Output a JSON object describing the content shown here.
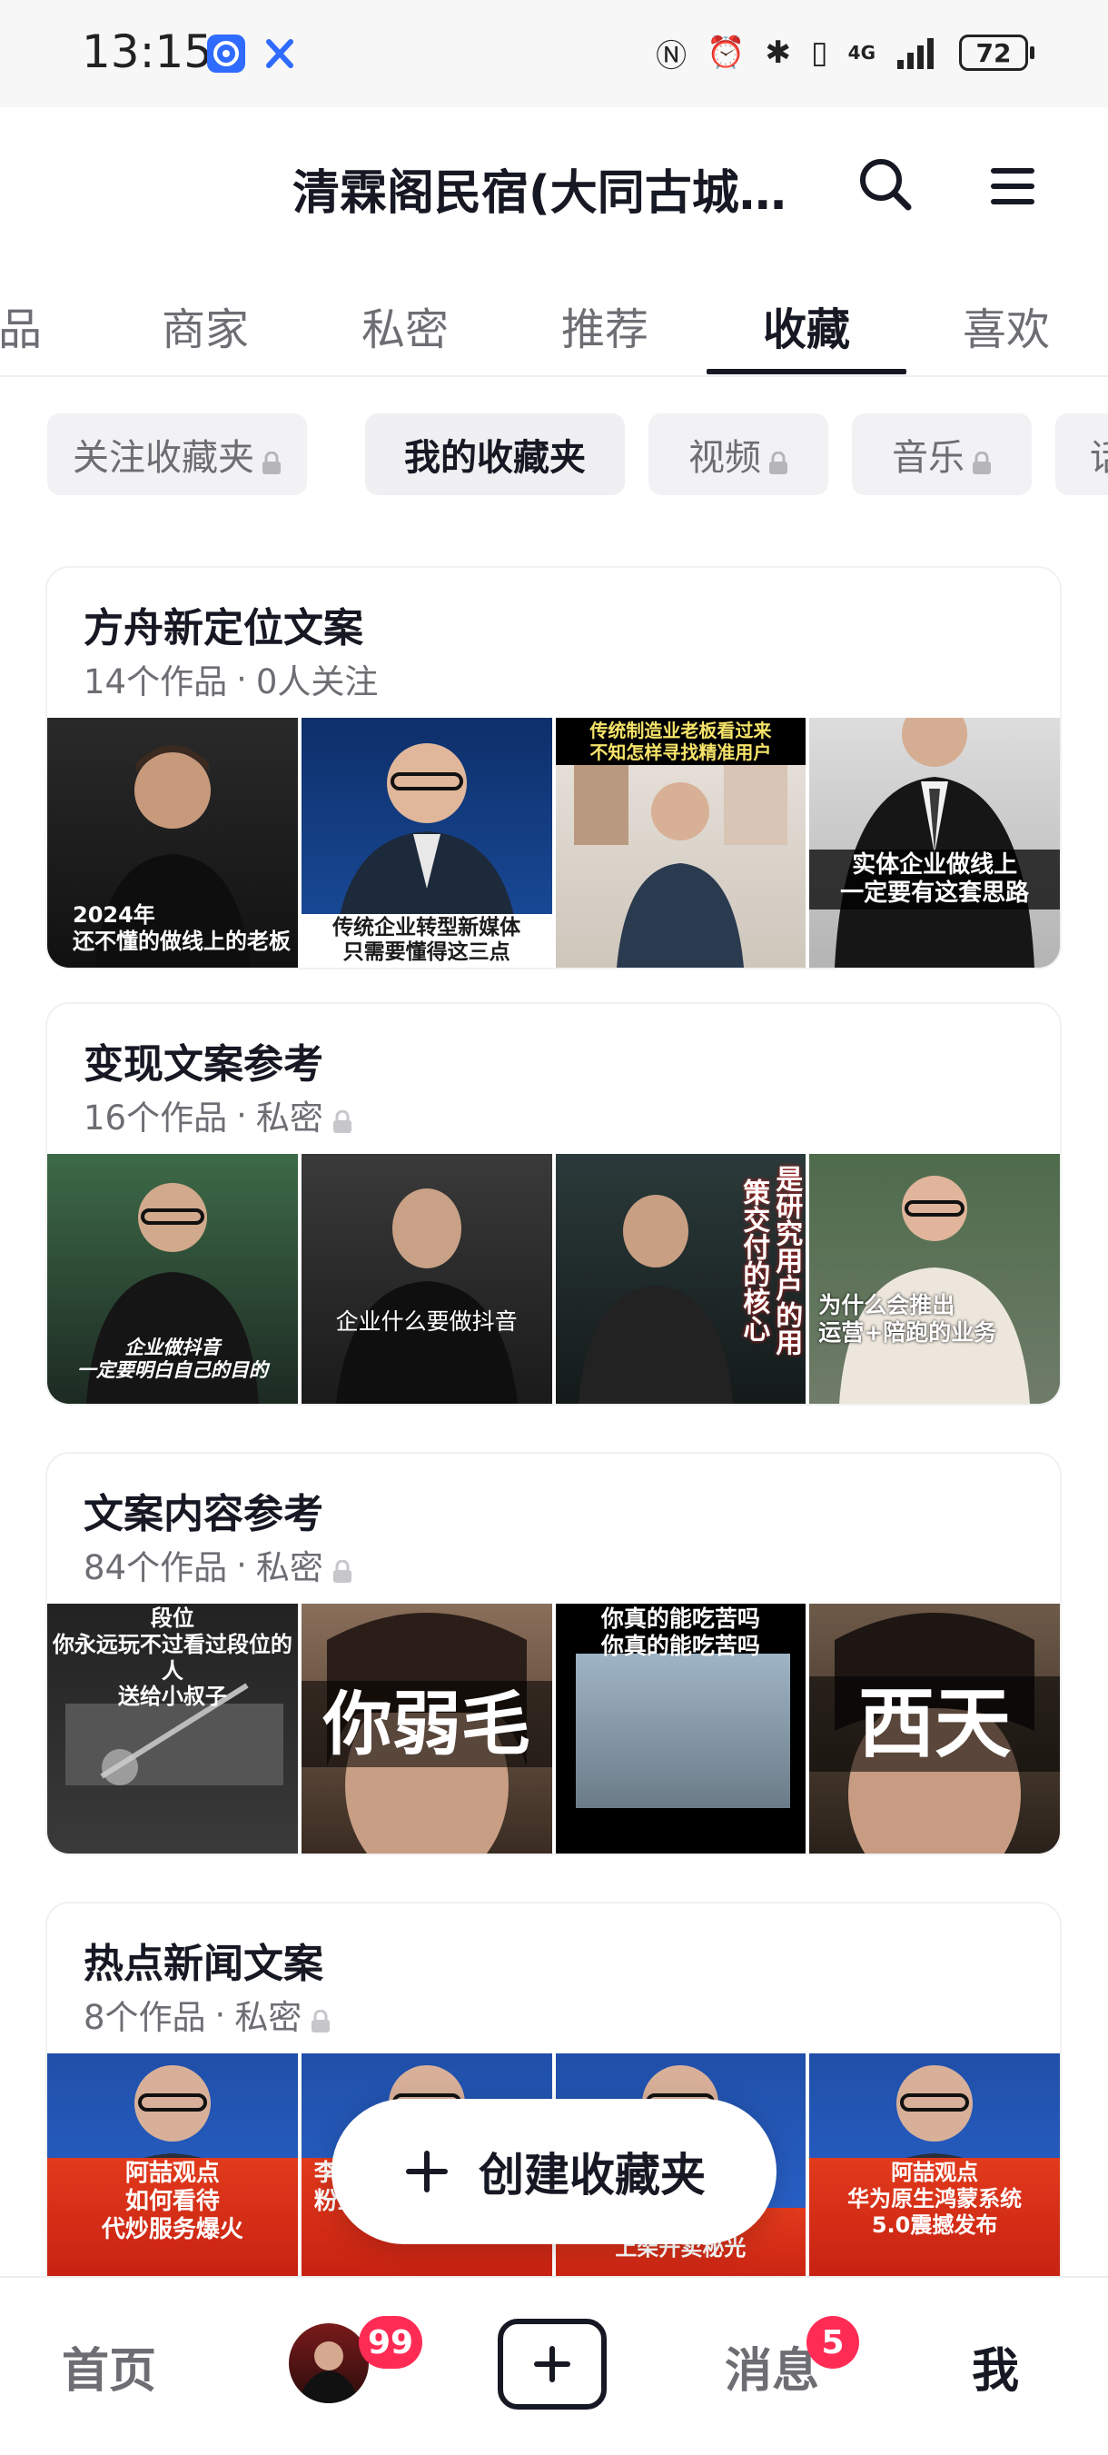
{
  "status_bar": {
    "time": "13:15",
    "battery": "72",
    "network": "4G"
  },
  "header": {
    "title": "清霖阁民宿(大同古城…"
  },
  "tabs": [
    {
      "label": "品"
    },
    {
      "label": "商家"
    },
    {
      "label": "私密"
    },
    {
      "label": "推荐"
    },
    {
      "label": "收藏"
    },
    {
      "label": "喜欢"
    }
  ],
  "chips": [
    {
      "label": "关注收藏夹"
    },
    {
      "label": "我的收藏夹"
    },
    {
      "label": "视频"
    },
    {
      "label": "音乐"
    },
    {
      "label": "话"
    }
  ],
  "folders": [
    {
      "name": "方舟新定位文案",
      "count": "14个作品",
      "status": "0人关注",
      "thumbs": [
        "2024年\n还不懂的做线上的老板",
        "传统企业转型新媒体\n只需要懂得这三点",
        "传统制造业老板看过来\n不知怎样寻找精准用户",
        "实体企业做线上\n一定要有这套思路"
      ]
    },
    {
      "name": "变现文案参考",
      "count": "16个作品",
      "status": "私密",
      "thumbs": [
        "企业做抖音\n一定要明白自己的目的",
        "企业什么要做抖音",
        "是研究用户的用\n策交付的核心",
        "为什么会推出\n运营+陪跑的业务"
      ]
    },
    {
      "name": "文案内容参考",
      "count": "84个作品",
      "status": "私密",
      "thumbs": [
        "段位\n你永远玩不过看过段位的人\n送给小叔子",
        "你弱毛",
        "你真的能吃苦吗\n你真的能吃苦吗",
        "西天"
      ]
    },
    {
      "name": "热点新闻文案",
      "count": "8个作品",
      "status": "私密",
      "thumbs": [
        "阿喆观点\n如何看待\n代炒服务爆火",
        "李\n粉丝盼回归",
        "上架开卖秘光",
        "阿喆观点\n华为原生鸿蒙系统\n5.0震撼发布"
      ]
    }
  ],
  "fab": {
    "label": "创建收藏夹"
  },
  "bottom_nav": {
    "home": "首页",
    "avatar_badge": "99",
    "messages": "消息",
    "messages_badge": "5",
    "me": "我"
  },
  "colors": {
    "accent": "#fe2c55",
    "text": "#161823",
    "muted": "#6d6d73"
  }
}
